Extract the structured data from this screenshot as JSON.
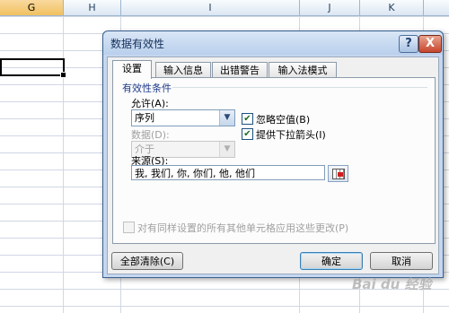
{
  "sheet": {
    "columns": [
      "G",
      "H",
      "I",
      "J",
      "K"
    ],
    "selected_column": "G"
  },
  "dialog": {
    "title": "数据有效性",
    "help_label": "?",
    "close_label": "X",
    "tabs": [
      "设置",
      "输入信息",
      "出错警告",
      "输入法模式"
    ],
    "group_label": "有效性条件",
    "allow_label": "允许(A):",
    "allow_value": "序列",
    "data_label": "数据(D):",
    "data_value": "介于",
    "ignore_blank_label": "忽略空值(B)",
    "ignore_blank_checked": true,
    "dropdown_label": "提供下拉箭头(I)",
    "dropdown_checked": true,
    "source_label": "来源(S):",
    "source_value": "我, 我们, 你, 你们, 他, 他们",
    "apply_all_label": "对有同样设置的所有其他单元格应用这些更改(P)",
    "apply_all_checked": false,
    "clear_all_label": "全部清除(C)",
    "ok_label": "确定",
    "cancel_label": "取消"
  },
  "watermark": "Bai du 经验",
  "icons": {
    "dropdown": "chevron-down-icon",
    "check": "checkmark-icon",
    "range_select": "collapse-dialog-icon"
  }
}
